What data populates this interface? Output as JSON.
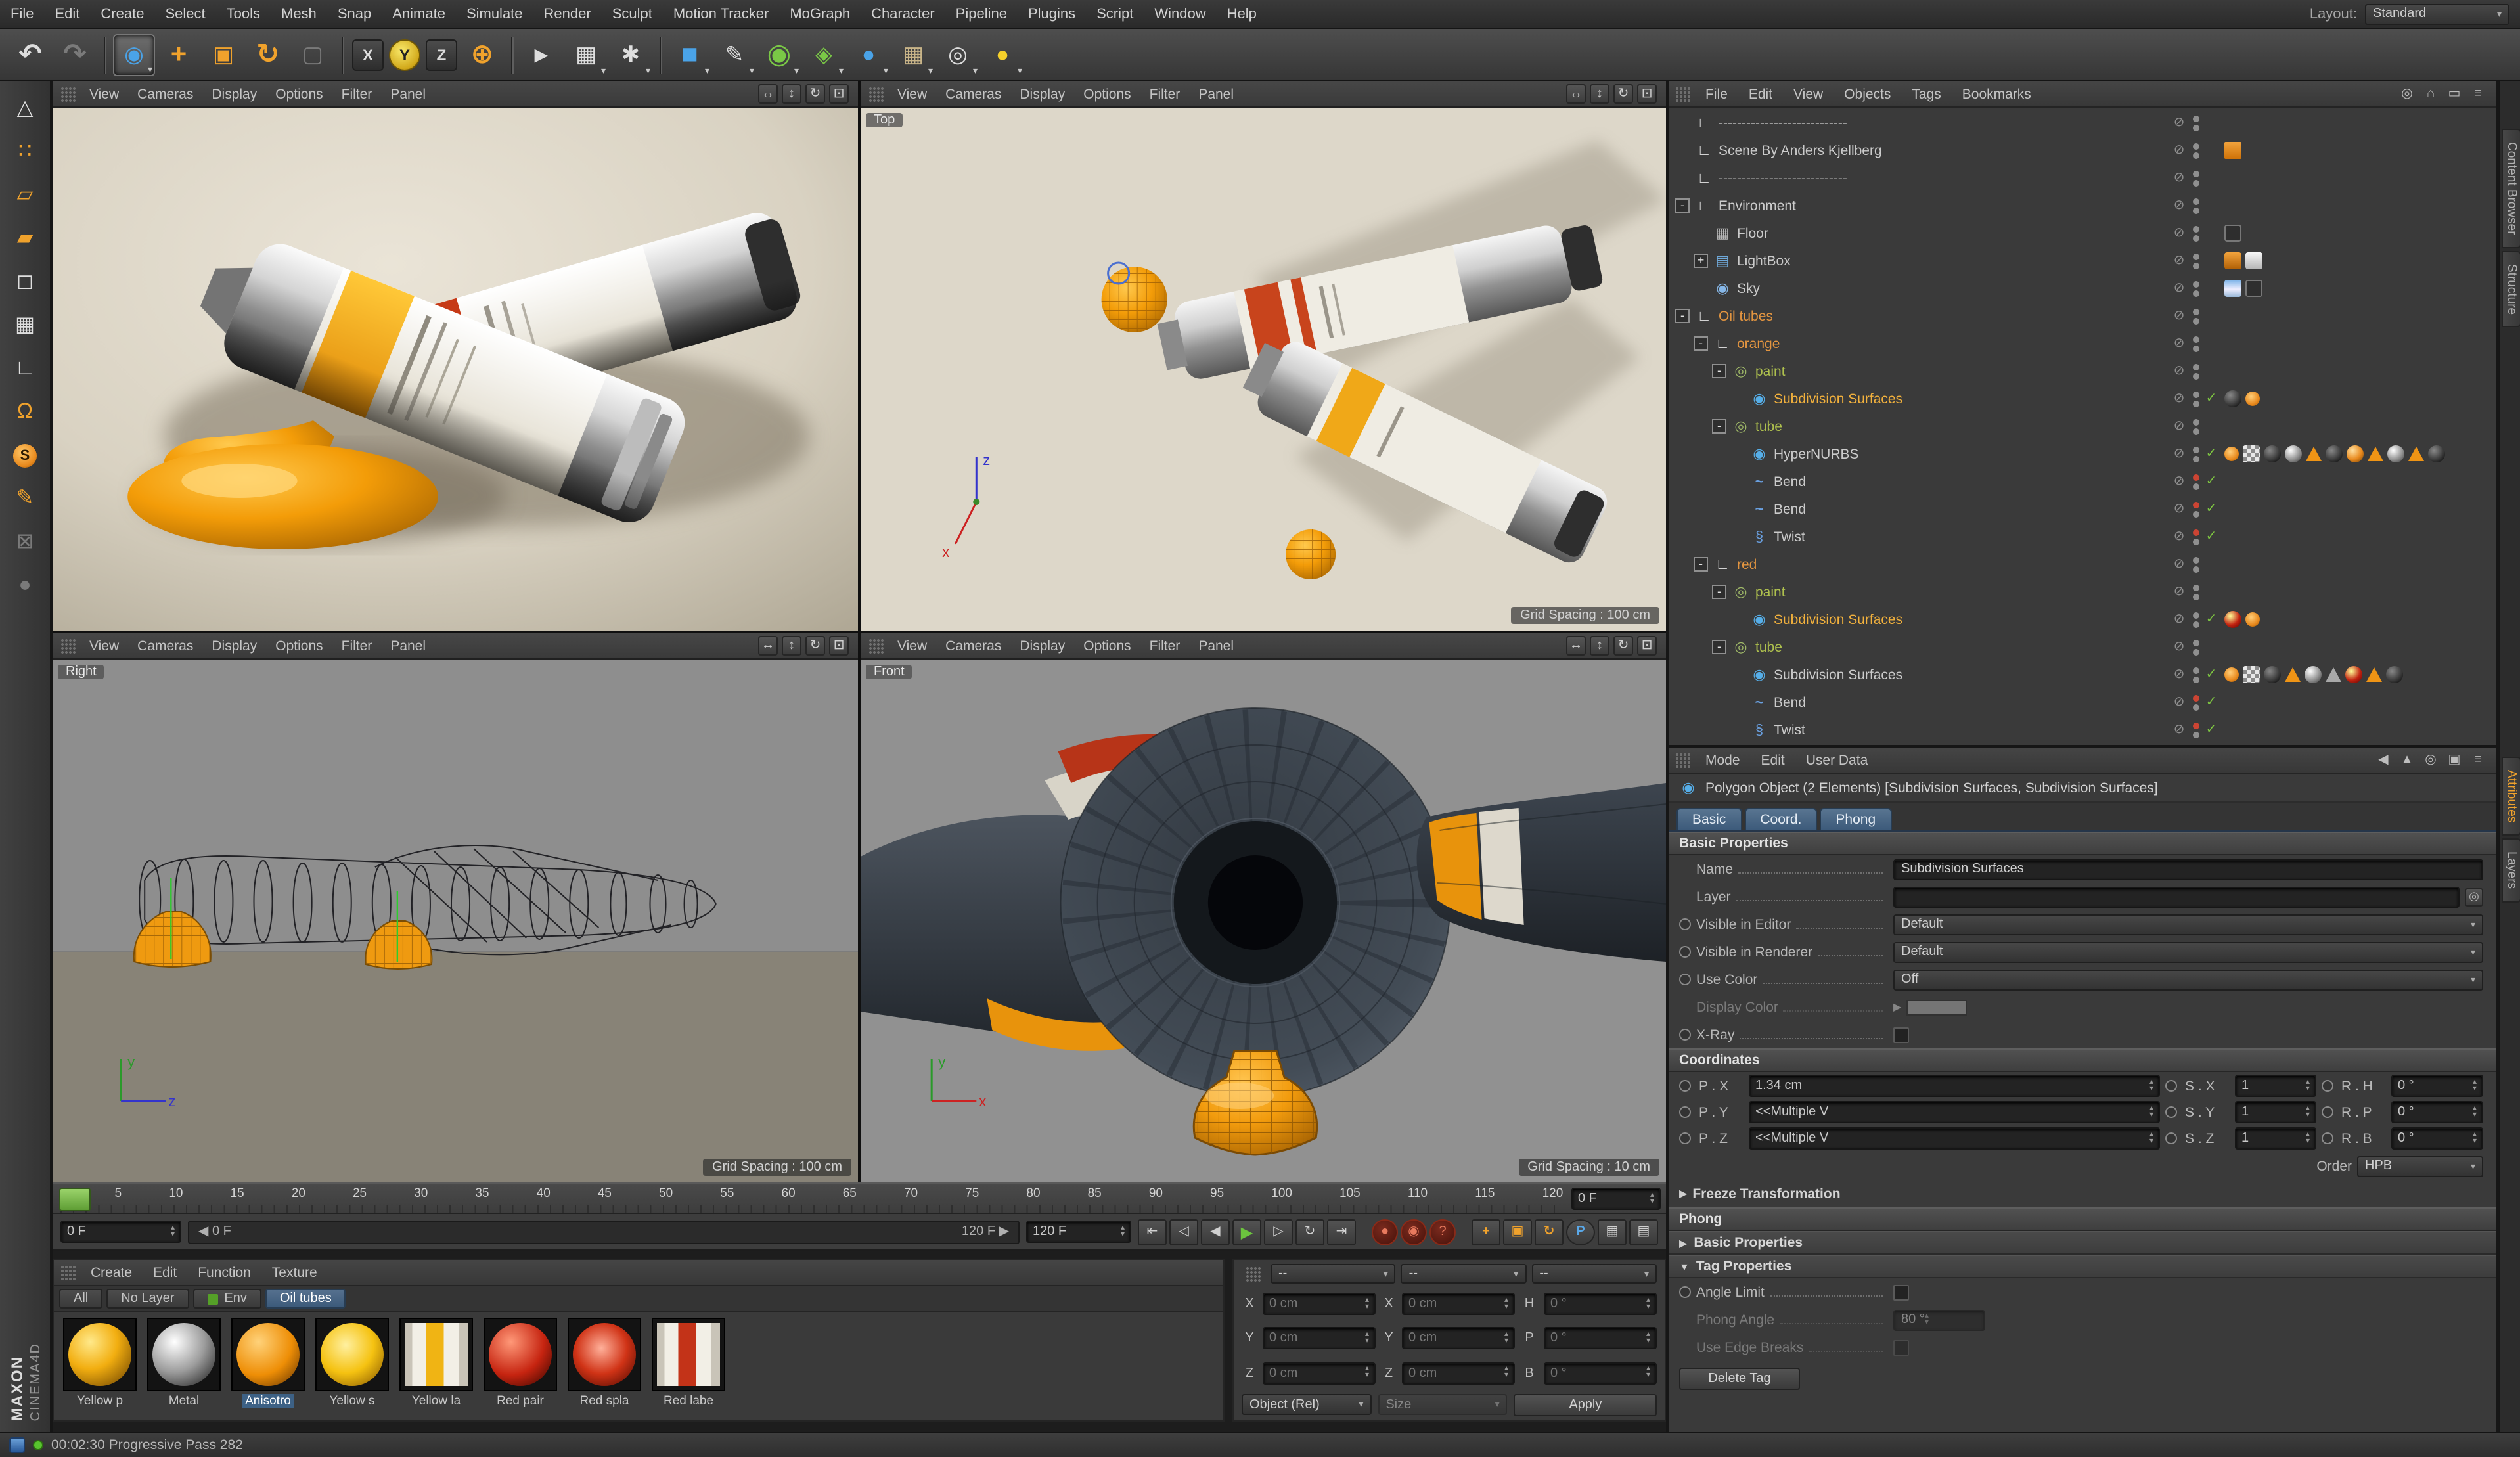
{
  "app": {
    "menubar": [
      "File",
      "Edit",
      "Create",
      "Select",
      "Tools",
      "Mesh",
      "Snap",
      "Animate",
      "Simulate",
      "Render",
      "Sculpt",
      "Motion Tracker",
      "MoGraph",
      "Character",
      "Pipeline",
      "Plugins",
      "Script",
      "Window",
      "Help"
    ],
    "layout_label": "Layout:",
    "layout_value": "Standard"
  },
  "colors": {
    "accent_orange": "#e8891d",
    "selection_blue": "#3d6185",
    "timeline_green": "#62b43e",
    "viewport_beige": "#d9d2c2",
    "record_red": "#c0392b"
  },
  "toolbar": {
    "tools": [
      {
        "n": "undo-button",
        "g": "↶",
        "c": "g-light big"
      },
      {
        "n": "redo-button",
        "g": "↷",
        "c": "g-dim big"
      },
      {
        "d": true
      },
      {
        "n": "live-selection-tool",
        "g": "◉",
        "c": "g-blue",
        "sel": true,
        "a": true
      },
      {
        "n": "move-tool",
        "g": "+",
        "c": "g-orange big"
      },
      {
        "n": "scale-tool",
        "g": "▣",
        "c": "g-orange"
      },
      {
        "n": "rotate-tool",
        "g": "↻",
        "c": "g-orange big"
      },
      {
        "n": "last-used-tool",
        "g": "▢",
        "c": "g-dim"
      },
      {
        "d": true
      },
      {
        "n": "axis-x-lock",
        "g": "X",
        "axis": true
      },
      {
        "n": "axis-y-lock",
        "g": "Y",
        "axis": true,
        "active": true
      },
      {
        "n": "axis-z-lock",
        "g": "Z",
        "axis": true
      },
      {
        "n": "coordinate-system-toggle",
        "g": "⊕",
        "c": "g-orange big"
      },
      {
        "d": true
      },
      {
        "n": "render-view-button",
        "g": "▸",
        "c": "g-light big"
      },
      {
        "n": "render-picture-viewer-button",
        "g": "▦",
        "c": "g-light",
        "a": true
      },
      {
        "n": "render-settings-button",
        "g": "✱",
        "c": "g-light",
        "a": true
      },
      {
        "d": true
      },
      {
        "n": "add-cube-button",
        "g": "■",
        "c": "g-blue big",
        "a": true
      },
      {
        "n": "add-spline-button",
        "g": "✎",
        "c": "g-light",
        "a": true
      },
      {
        "n": "add-subdivision-surface-button",
        "g": "◉",
        "c": "g-green big",
        "a": true
      },
      {
        "n": "add-mograph-button",
        "g": "◈",
        "c": "g-green",
        "a": true
      },
      {
        "n": "add-simulation-button",
        "g": "●",
        "c": "g-blue",
        "a": true
      },
      {
        "n": "add-environment-button",
        "g": "▦",
        "c": "g-tan",
        "a": true
      },
      {
        "n": "add-camera-button",
        "g": "◎",
        "c": "g-light",
        "a": true
      },
      {
        "n": "add-light-button",
        "g": "●",
        "c": "g-yellow",
        "a": true
      }
    ]
  },
  "left_toolbar": {
    "tools": [
      {
        "n": "make-editable-icon",
        "g": "△",
        "c": "g-light"
      },
      {
        "n": "points-mode-icon",
        "g": "∷",
        "c": "g-orange"
      },
      {
        "n": "edges-mode-icon",
        "g": "▱",
        "c": "g-orange"
      },
      {
        "n": "polygons-mode-icon",
        "g": "▰",
        "c": "g-orange"
      },
      {
        "n": "model-mode-icon",
        "g": "◻",
        "c": "g-light"
      },
      {
        "n": "texture-mode-icon",
        "g": "▦",
        "c": "g-light"
      },
      {
        "n": "workplane-icon",
        "g": "∟",
        "c": "g-light"
      },
      {
        "n": "snap-magnet-icon",
        "g": "Ω",
        "c": "g-orange"
      },
      {
        "n": "enable-snap-icon",
        "g": "S",
        "c": "chip"
      },
      {
        "n": "paint-tool-icon",
        "g": "✎",
        "c": "g-orange"
      },
      {
        "n": "lock-icon",
        "g": "⊠",
        "c": "g-dim"
      },
      {
        "n": "viewport-filter-icon",
        "g": "●",
        "c": "g-dim"
      }
    ]
  },
  "viewports": {
    "menus": [
      "View",
      "Cameras",
      "Display",
      "Options",
      "Filter",
      "Panel"
    ],
    "right_icons": [
      {
        "name": "pan-view-icon",
        "glyph": "↔"
      },
      {
        "name": "dolly-view-icon",
        "glyph": "↕"
      },
      {
        "name": "rotate-view-icon",
        "glyph": "↻"
      },
      {
        "name": "toggle-view-icon",
        "glyph": "⊡"
      }
    ],
    "panes": [
      {
        "name": "perspective",
        "label": "",
        "grid": ""
      },
      {
        "name": "top",
        "label": "Top",
        "grid": "Grid Spacing : 100 cm"
      },
      {
        "name": "right",
        "label": "Right",
        "grid": "Grid Spacing : 100 cm"
      },
      {
        "name": "front",
        "label": "Front",
        "grid": "Grid Spacing : 10 cm"
      }
    ]
  },
  "timeline": {
    "ticks": [
      "0",
      "5",
      "10",
      "15",
      "20",
      "25",
      "30",
      "35",
      "40",
      "45",
      "50",
      "55",
      "60",
      "65",
      "70",
      "75",
      "80",
      "85",
      "90",
      "95",
      "100",
      "105",
      "110",
      "115",
      "120"
    ],
    "ruler_field": "0 F",
    "current_field": "0 F",
    "range_start": "◀ 0 F",
    "range_end": "120 F ▶",
    "end_field": "120 F"
  },
  "transport": {
    "buttons": [
      {
        "name": "goto-start-button",
        "glyph": "⇤"
      },
      {
        "name": "prev-key-button",
        "glyph": "◁"
      },
      {
        "name": "prev-frame-button",
        "glyph": "◀"
      },
      {
        "name": "play-button",
        "glyph": "▶",
        "cls": "play"
      },
      {
        "name": "next-frame-button",
        "glyph": "▷"
      },
      {
        "name": "loop-button",
        "glyph": "↻"
      },
      {
        "name": "goto-end-button",
        "glyph": "⇥"
      },
      {
        "gap": true
      },
      {
        "name": "record-keyframe-button",
        "glyph": "●",
        "cls": "rec"
      },
      {
        "name": "autokey-button",
        "glyph": "◉",
        "cls": "rec"
      },
      {
        "name": "keyframe-help-button",
        "glyph": "?",
        "cls": "rec"
      },
      {
        "gap": true
      },
      {
        "name": "key-position-button",
        "glyph": "+",
        "cls": "orange"
      },
      {
        "name": "key-scale-button",
        "glyph": "▣",
        "cls": "orange"
      },
      {
        "name": "key-rotation-button",
        "glyph": "↻",
        "cls": "orange"
      },
      {
        "name": "key-parameter-button",
        "glyph": "P",
        "cls": "blue"
      },
      {
        "name": "keyframe-selection-button",
        "glyph": "▦"
      },
      {
        "name": "timeline-panel-button",
        "glyph": "▤"
      }
    ]
  },
  "materials": {
    "menus": [
      "Create",
      "Edit",
      "Function",
      "Texture"
    ],
    "tabs": [
      {
        "label": "All"
      },
      {
        "label": "No Layer"
      },
      {
        "label": "Env",
        "chip": "#55a028"
      },
      {
        "label": "Oil tubes",
        "active": true
      }
    ],
    "items": [
      {
        "name": "Yellow p",
        "thumb": "sphere-yellow"
      },
      {
        "name": "Metal",
        "thumb": "sphere-gray"
      },
      {
        "name": "Anisotro",
        "thumb": "sphere-orange",
        "selected": true
      },
      {
        "name": "Yellow s",
        "thumb": "sphere-yellow2"
      },
      {
        "name": "Yellow la",
        "thumb": "label-yellow"
      },
      {
        "name": "Red pair",
        "thumb": "sphere-red"
      },
      {
        "name": "Red spla",
        "thumb": "sphere-red2"
      },
      {
        "name": "Red labe",
        "thumb": "label-red"
      }
    ]
  },
  "coordinates": {
    "headers": [
      "--",
      "--",
      "--"
    ],
    "rows": [
      {
        "l1": "X",
        "v1": "0 cm",
        "l2": "X",
        "v2": "0 cm",
        "l3": "H",
        "v3": "0 °"
      },
      {
        "l1": "Y",
        "v1": "0 cm",
        "l2": "Y",
        "v2": "0 cm",
        "l3": "P",
        "v3": "0 °"
      },
      {
        "l1": "Z",
        "v1": "0 cm",
        "l2": "Z",
        "v2": "0 cm",
        "l3": "B",
        "v3": "0 °"
      }
    ],
    "mode": "Object (Rel)",
    "size_mode": "Size",
    "apply": "Apply"
  },
  "object_manager": {
    "menus": [
      "File",
      "Edit",
      "View",
      "Objects",
      "Tags",
      "Bookmarks"
    ],
    "right_icons": [
      {
        "name": "search-icon",
        "glyph": "◎"
      },
      {
        "name": "home-icon",
        "glyph": "⌂"
      },
      {
        "name": "minimize-icon",
        "glyph": "▭"
      },
      {
        "name": "panel-menu-icon",
        "glyph": "≡"
      }
    ],
    "icon_glyphs": {
      "null": "∟",
      "floor": "▦",
      "lightbox": "▤",
      "sky": "◉",
      "sphereq": "◎",
      "subdiv": "◉",
      "bend": "~",
      "twist": "§"
    },
    "rows": [
      {
        "i": 0,
        "ic": "null",
        "l": "----------------------------",
        "c": "dim"
      },
      {
        "i": 0,
        "ic": "null",
        "l": "Scene By Anders Kjellberg",
        "t": [
          "note"
        ]
      },
      {
        "i": 0,
        "ic": "null",
        "l": "----------------------------",
        "c": "dim"
      },
      {
        "i": 0,
        "e": "-",
        "ic": "null",
        "l": "Environment"
      },
      {
        "i": 1,
        "ic": "floor",
        "l": "Floor",
        "t": [
          "compositing"
        ]
      },
      {
        "i": 1,
        "e": "+",
        "ic": "lightbox",
        "l": "LightBox",
        "t": [
          "tex-orange",
          "tex-white"
        ]
      },
      {
        "i": 1,
        "ic": "sky",
        "l": "Sky",
        "t": [
          "tex-sky",
          "compositing"
        ]
      },
      {
        "i": 0,
        "e": "-",
        "ic": "null",
        "l": "Oil tubes",
        "c": "orange"
      },
      {
        "i": 1,
        "e": "-",
        "ic": "null",
        "l": "orange",
        "c": "orange"
      },
      {
        "i": 2,
        "e": "-",
        "ic": "sphereq",
        "l": "paint",
        "c": "green"
      },
      {
        "i": 3,
        "ic": "subdiv",
        "l": "Subdivision Surfaces",
        "c": "selected",
        "v": "check",
        "t": [
          "sphere-black",
          "dot-orange"
        ]
      },
      {
        "i": 2,
        "e": "-",
        "ic": "sphereq",
        "l": "tube",
        "c": "green"
      },
      {
        "i": 3,
        "ic": "subdiv",
        "l": "HyperNURBS",
        "v": "check",
        "t": [
          "dot-orange",
          "checker",
          "sphere-black",
          "sphere-gray",
          "tri-orange",
          "sphere-black",
          "sphere-orange",
          "tri-orange",
          "sphere-gray",
          "tri-orange",
          "sphere-black"
        ]
      },
      {
        "i": 3,
        "ic": "bend",
        "l": "Bend",
        "v": "redcheck"
      },
      {
        "i": 3,
        "ic": "bend",
        "l": "Bend",
        "v": "redcheck"
      },
      {
        "i": 3,
        "ic": "twist",
        "l": "Twist",
        "v": "redcheck"
      },
      {
        "i": 1,
        "e": "-",
        "ic": "null",
        "l": "red",
        "c": "orange"
      },
      {
        "i": 2,
        "e": "-",
        "ic": "sphereq",
        "l": "paint",
        "c": "green"
      },
      {
        "i": 3,
        "ic": "subdiv",
        "l": "Subdivision Surfaces",
        "c": "selected",
        "v": "check",
        "t": [
          "sphere-red",
          "dot-orange"
        ]
      },
      {
        "i": 2,
        "e": "-",
        "ic": "sphereq",
        "l": "tube",
        "c": "green"
      },
      {
        "i": 3,
        "ic": "subdiv",
        "l": "Subdivision Surfaces",
        "v": "check",
        "t": [
          "dot-orange",
          "checker",
          "sphere-black",
          "tri-orange",
          "sphere-gray",
          "tri-gray",
          "sphere-red",
          "tri-orange",
          "sphere-black"
        ]
      },
      {
        "i": 3,
        "ic": "bend",
        "l": "Bend",
        "v": "redcheck"
      },
      {
        "i": 3,
        "ic": "twist",
        "l": "Twist",
        "v": "redcheck"
      }
    ]
  },
  "attributes": {
    "menus": [
      "Mode",
      "Edit",
      "User Data"
    ],
    "right_icons": [
      {
        "name": "back-icon",
        "glyph": "◀"
      },
      {
        "name": "up-icon",
        "glyph": "▲"
      },
      {
        "name": "search-icon",
        "glyph": "◎"
      },
      {
        "name": "lock-icon",
        "glyph": "▣"
      },
      {
        "name": "panel-menu-icon",
        "glyph": "≡"
      }
    ],
    "title": "Polygon Object (2 Elements) [Subdivision Surfaces, Subdivision Surfaces]",
    "tabs": [
      "Basic",
      "Coord.",
      "Phong"
    ],
    "basic_header": "Basic Properties",
    "name_label": "Name",
    "name_value": "Subdivision Surfaces",
    "layer_label": "Layer",
    "visible_editor_label": "Visible in Editor",
    "visible_editor_value": "Default",
    "visible_renderer_label": "Visible in Renderer",
    "visible_renderer_value": "Default",
    "use_color_label": "Use Color",
    "use_color_value": "Off",
    "display_color_label": "Display Color",
    "xray_label": "X-Ray",
    "coordinates_header": "Coordinates",
    "coord_rows": [
      {
        "pl": "P . X",
        "pv": "1.34 cm",
        "sl": "S . X",
        "sv": "1",
        "rl": "R . H",
        "rv": "0 °"
      },
      {
        "pl": "P . Y",
        "pv": "<<Multiple V",
        "sl": "S . Y",
        "sv": "1",
        "rl": "R . P",
        "rv": "0 °"
      },
      {
        "pl": "P . Z",
        "pv": "<<Multiple V",
        "sl": "S . Z",
        "sv": "1",
        "rl": "R . B",
        "rv": "0 °"
      }
    ],
    "order_label": "Order",
    "order_value": "HPB",
    "freeze_label": "Freeze Transformation",
    "phong_header": "Phong",
    "phong_basic_label": "Basic Properties",
    "phong_tag_label": "Tag Properties",
    "angle_limit_label": "Angle Limit",
    "phong_angle_label": "Phong Angle",
    "phong_angle_value": "80 °",
    "edge_breaks_label": "Use Edge Breaks",
    "delete_tag_label": "Delete Tag"
  },
  "edge_tabs": {
    "top": [
      {
        "label": "Content Browser"
      },
      {
        "label": "Structure"
      }
    ],
    "bottom": [
      {
        "label": "Attributes",
        "active": true
      },
      {
        "label": "Layers"
      }
    ]
  },
  "status": {
    "text": "00:02:30 Progressive Pass 282"
  },
  "brand": {
    "line1": "MAXON",
    "line2": "CINEMA4D"
  }
}
